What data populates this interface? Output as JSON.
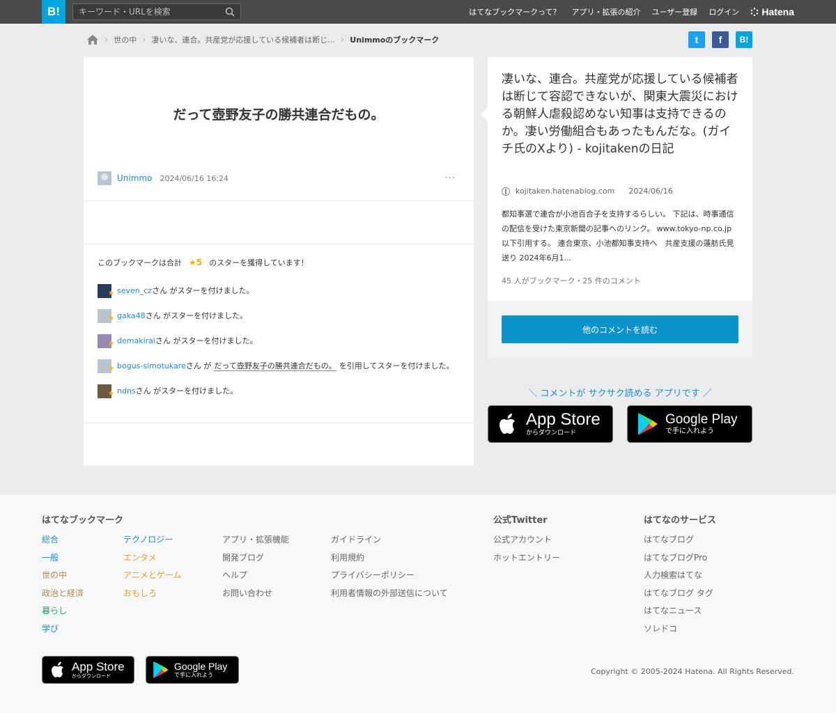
{
  "header": {
    "logo": "B!",
    "search_placeholder": "キーワード・URLを検索",
    "nav": [
      "はてなブックマークって？",
      "アプリ・拡張の紹介",
      "ユーザー登録",
      "ログイン"
    ],
    "hatena": "Hatena"
  },
  "breadcrumb": {
    "items": [
      "世の中",
      "凄いな、連合。共産党が応援している候補者は断じ…",
      "Unimmoのブックマーク"
    ]
  },
  "share": {
    "twitter": "t",
    "facebook": "f",
    "hatebu": "B!"
  },
  "bookmark": {
    "comment": "だって壺野友子の勝共連合だもの。",
    "user": "Unimmo",
    "date": "2024/06/16 16:24",
    "more": "···",
    "star_prefix": "このブックマークは合計",
    "star_count": "★5",
    "star_suffix": "のスターを獲得しています！",
    "stars": [
      {
        "user": "seven_cz",
        "text": "さん がスターを付けました。"
      },
      {
        "user": "gaka48",
        "text": "さん がスターを付けました。"
      },
      {
        "user": "demakirai",
        "text": "さん がスターを付けました。"
      },
      {
        "user": "bogus-simotukare",
        "pre": "さん が",
        "quote": "だって壺野友子の勝共連合だもの。",
        "post": "を引用してスターを付けました。"
      },
      {
        "user": "ndns",
        "text": "さん がスターを付けました。"
      }
    ]
  },
  "entry": {
    "title": "凄いな、連合。共産党が応援している候補者は断じて容認できないが、関東大震災における朝鮮人虐殺認めない知事は支持できるのか。凄い労働組合もあったもんだな。(ガイチ氏のXより) - kojitakenの日記",
    "domain": "kojitaken.hatenablog.com",
    "date": "2024/06/16",
    "description": "都知事選で連合が小池百合子を支持するらしい。 下記は、時事通信の配信を受けた東京新聞の記事へのリンク。 www.tokyo-np.co.jp 以下引用する。 連合東京、小池都知事支持へ　共産支援の蓮舫氏見送り 2024年6月1...",
    "stats": "45 人がブックマーク・25 件のコメント",
    "read_button": "他のコメントを読む"
  },
  "promo": {
    "tagline": "＼ コメントが サクサク読める アプリです ／",
    "appstore_big": "App Store",
    "appstore_small": "からダウンロード",
    "googleplay_big": "Google Play",
    "googleplay_small": "で手に入れよう"
  },
  "footer": {
    "heading_bookmark": "はてなブックマーク",
    "heading_twitter": "公式Twitter",
    "heading_services": "はてなのサービス",
    "col1": [
      "総合",
      "一般",
      "世の中",
      "政治と経済",
      "暮らし",
      "学び"
    ],
    "col2": [
      "テクノロジー",
      "エンタメ",
      "アニメとゲーム",
      "おもしろ"
    ],
    "col3": [
      "アプリ・拡張機能",
      "開発ブログ",
      "ヘルプ",
      "お問い合わせ"
    ],
    "col4": [
      "ガイドライン",
      "利用規約",
      "プライバシーポリシー",
      "利用者情報の外部送信について"
    ],
    "twitter": [
      "公式アカウント",
      "ホットエントリー"
    ],
    "services": [
      "はてなブログ",
      "はてなブログPro",
      "人力検索はてな",
      "はてなブログ タグ",
      "はてなニュース",
      "ソレドコ"
    ],
    "copyright": "Copyright © 2005-2024 Hatena. All Rights Reserved."
  },
  "colors": {
    "accent": "#00a4de",
    "link": "#1a8fc7",
    "star": "#f5b100",
    "header": "#4a4a4a"
  }
}
